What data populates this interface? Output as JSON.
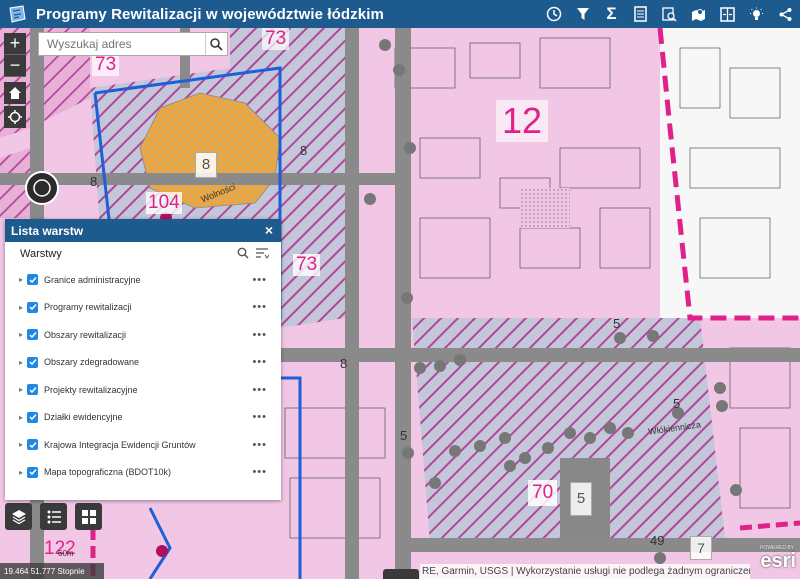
{
  "header": {
    "title": "Programy Rewitalizacji w województwie łódzkim",
    "background": "#1d5a8e",
    "tools": [
      "history-icon",
      "filter-icon",
      "sigma-icon",
      "document-icon",
      "search-data-icon",
      "map-pin-icon",
      "split-view-icon",
      "lightbulb-icon",
      "share-icon"
    ]
  },
  "search": {
    "placeholder": "Wyszukaj adres"
  },
  "zoom": {
    "in": "+",
    "out": "−"
  },
  "map_labels": {
    "area73a": "73",
    "area73b": "73",
    "area73c": "73",
    "area12": "12",
    "area104": "104",
    "area70": "70",
    "area122": "122",
    "area7": "7",
    "area49": "49",
    "street_wolnosci": "Wolności",
    "street_wlokiennicza": "Włókiennicza",
    "box8": "8",
    "box5": "5",
    "road8": "8",
    "road5": "5"
  },
  "panel": {
    "title": "Lista warstw",
    "close": "×",
    "subtitle": "Warstwy",
    "more": "•••",
    "layers": [
      {
        "label": "Granice administracyjne"
      },
      {
        "label": "Programy rewitalizacji"
      },
      {
        "label": "Obszary rewitalizacji"
      },
      {
        "label": "Obszary zdegradowane"
      },
      {
        "label": "Projekty rewitalizacyjne"
      },
      {
        "label": "Działki ewidencyjne"
      },
      {
        "label": "Krajowa Integracja Ewidencji Gruntów"
      },
      {
        "label": "Mapa topograficzna (BDOT10k)"
      }
    ]
  },
  "scalebar": {
    "coords": "19.464 51.777 Stopnie",
    "scale": "60m"
  },
  "attribution": "RE, Garmin, USGS | Wykorzystanie usługi nie podlega żadnym ograniczeniom",
  "esri": {
    "powered": "POWERED BY",
    "logo": "esri"
  },
  "colors": {
    "pink": "#f2c7e6",
    "hatch": "#b0479a",
    "blue_boundary": "#1e5fd8",
    "orange": "#f5a623",
    "magenta_dashed": "#e0218a"
  }
}
